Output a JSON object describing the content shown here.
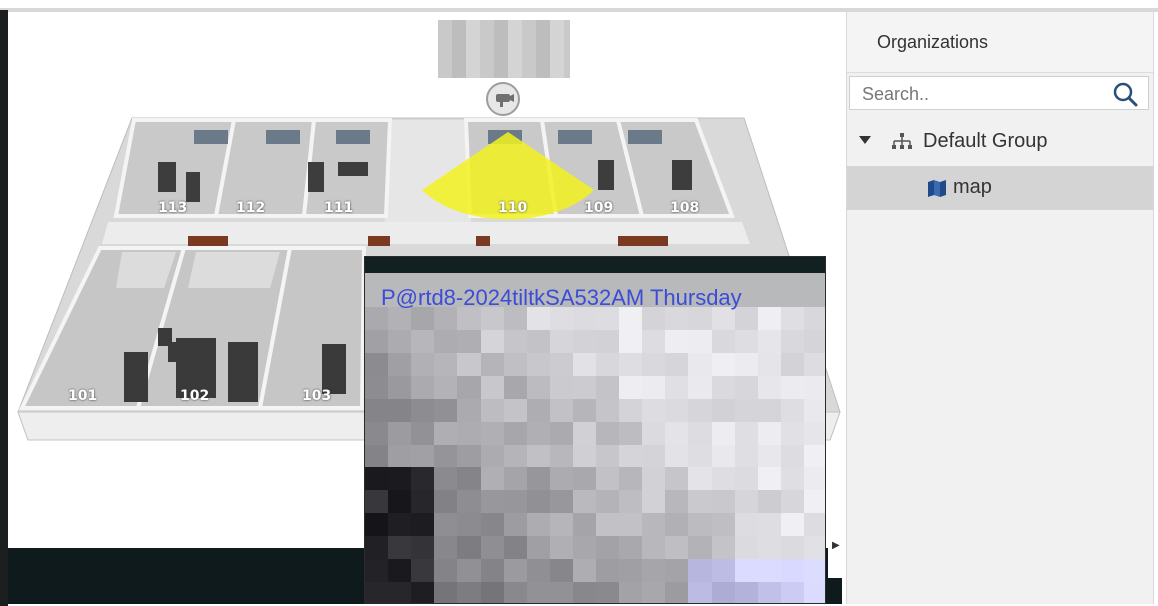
{
  "sidebar": {
    "title": "Organizations",
    "search": {
      "placeholder": "Search..",
      "value": ""
    },
    "tree": [
      {
        "label": "Default Group",
        "icon": "org-tree-icon",
        "expanded": true
      },
      {
        "label": "map",
        "icon": "map-icon",
        "selected": true
      }
    ]
  },
  "floorplan": {
    "rooms": [
      "113",
      "112",
      "111",
      "110",
      "109",
      "108",
      "101",
      "102",
      "103"
    ],
    "camera_coverage_color": "#f2f21e"
  },
  "video": {
    "overlay_text": "P@rtd8-2024tiltkSA532AM Thursday",
    "overlay_color": "#3c4cd8"
  },
  "colors": {
    "sidebar_bg": "#f1f1f1",
    "selected_row": "#d4d4d4",
    "accent_icon": "#1f4a8a"
  }
}
